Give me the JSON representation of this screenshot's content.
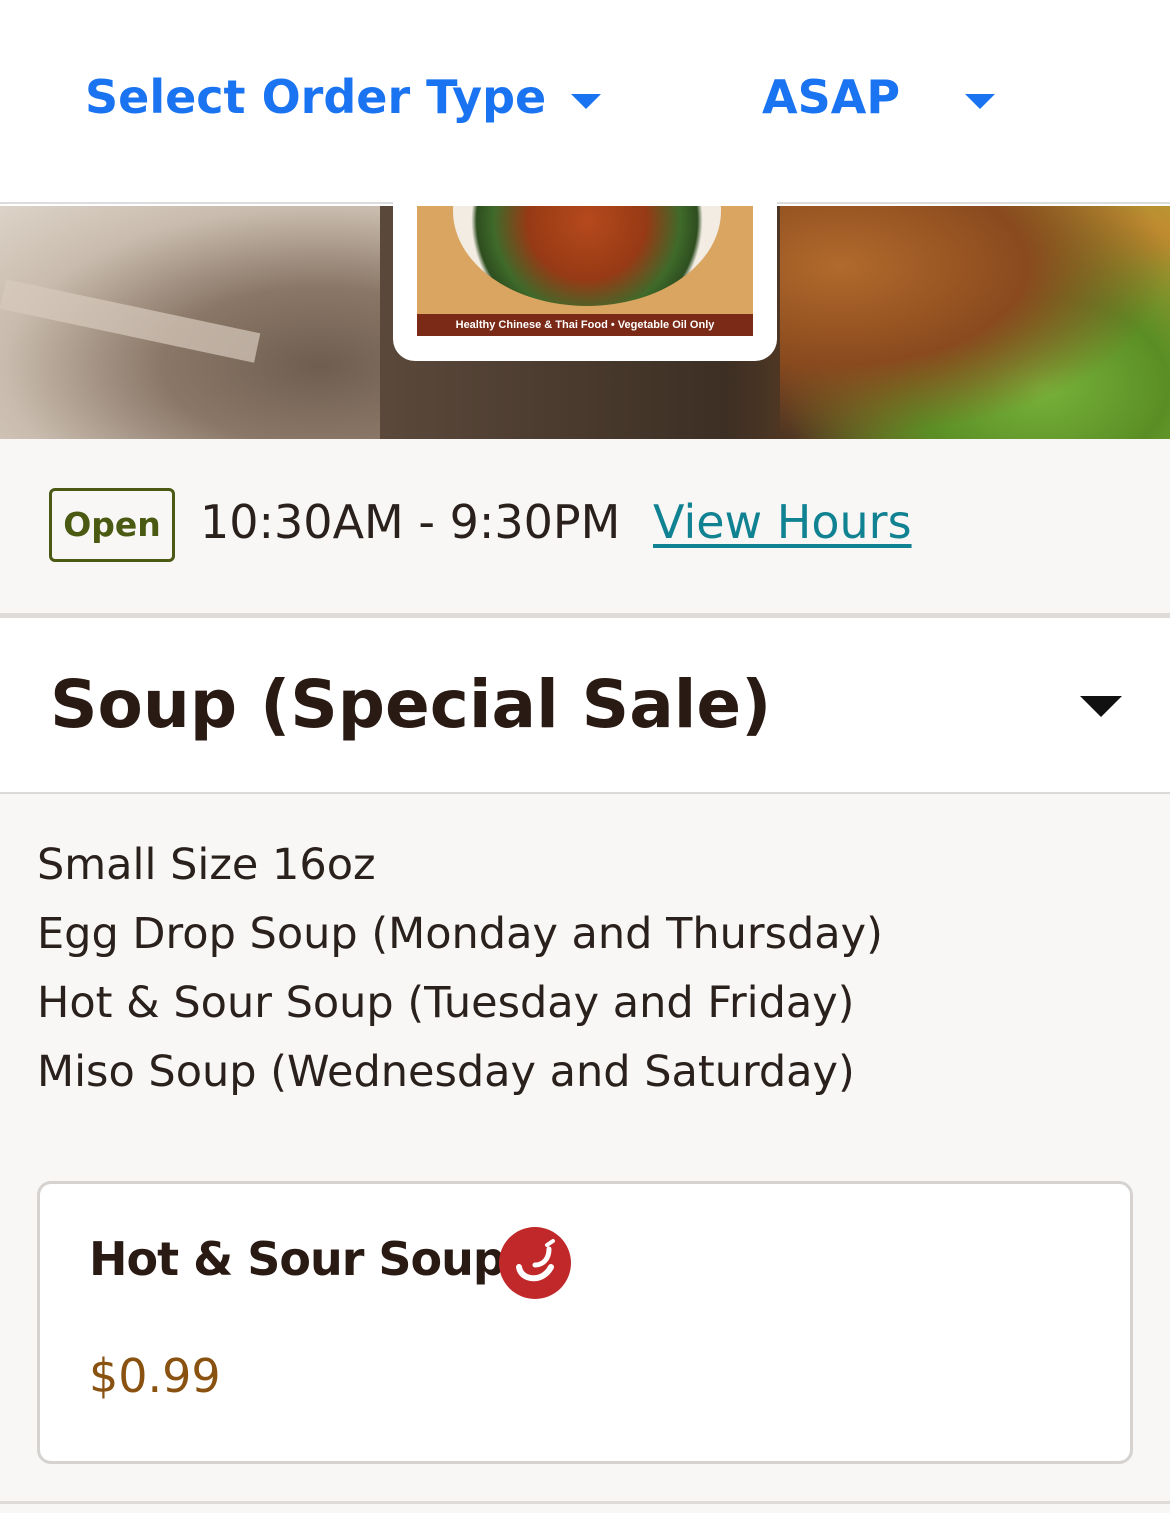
{
  "order_bar": {
    "order_type_label": "Select Order Type",
    "time_label": "ASAP"
  },
  "hero": {
    "logo_tagline": "Healthy Chinese & Thai Food • Vegetable Oil Only"
  },
  "hours": {
    "status": "Open",
    "range": "10:30AM - 9:30PM",
    "view_hours_label": "View Hours"
  },
  "section": {
    "title": "Soup (Special Sale)",
    "description": [
      "Small Size 16oz",
      "Egg Drop Soup (Monday and Thursday)",
      "Hot & Sour Soup (Tuesday and Friday)",
      "Miso Soup (Wednesday and Saturday)"
    ],
    "items": [
      {
        "name": "Hot & Sour Soup",
        "price": "$0.99",
        "badge_icon": "chili-pepper-icon"
      }
    ]
  },
  "colors": {
    "accent_blue": "#1a73f0",
    "open_green": "#4a5a12",
    "link_teal": "#118292",
    "price_brown": "#8a5210",
    "spicy_red": "#c0282a"
  }
}
